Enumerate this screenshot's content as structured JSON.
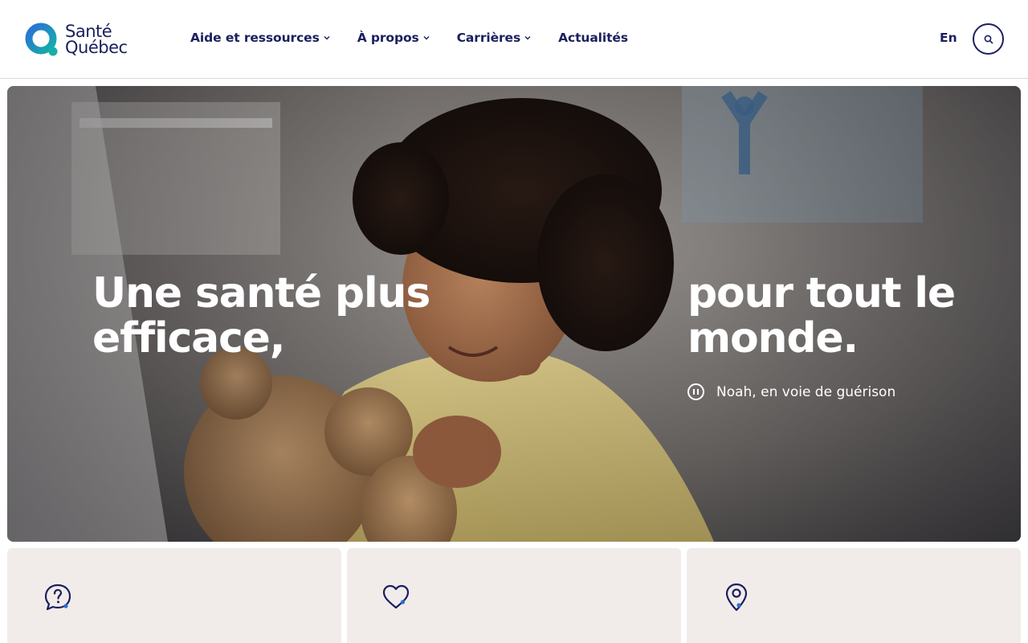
{
  "header": {
    "logo_line1": "Santé",
    "logo_line2": "Québec",
    "nav": [
      {
        "label": "Aide et ressources",
        "has_dropdown": true
      },
      {
        "label": "À propos",
        "has_dropdown": true
      },
      {
        "label": "Carrières",
        "has_dropdown": true
      },
      {
        "label": "Actualités",
        "has_dropdown": false
      }
    ],
    "lang": "En",
    "search_icon": "search-icon"
  },
  "hero": {
    "title_left": [
      "Une santé plus",
      "efficace,"
    ],
    "title_right": [
      "pour tout le",
      "monde."
    ],
    "caption": "Noah, en voie de guérison",
    "pause_icon": "pause-icon"
  },
  "cards": [
    {
      "icon": "question-bubble-icon"
    },
    {
      "icon": "heart-icon"
    },
    {
      "icon": "location-pin-icon"
    }
  ],
  "colors": {
    "brand_navy": "#1b1f5e",
    "brand_teal": "#1a9bb4",
    "brand_blue": "#2a6fd6",
    "card_bg": "#f1ecea"
  }
}
